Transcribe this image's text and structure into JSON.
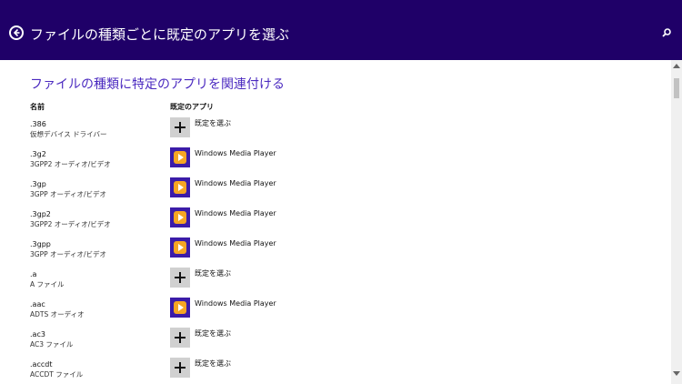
{
  "header": {
    "title": "ファイルの種類ごとに既定のアプリを選ぶ",
    "back_icon": "back-arrow-icon",
    "search_icon": "search-icon"
  },
  "section_title": "ファイルの種類に特定のアプリを関連付ける",
  "columns": {
    "name": "名前",
    "default_app": "既定のアプリ"
  },
  "rows": [
    {
      "ext": ".386",
      "desc": "仮想デバイス ドライバー",
      "app": "既定を選ぶ",
      "icon": "plus-icon"
    },
    {
      "ext": ".3g2",
      "desc": "3GPP2 オーディオ/ビデオ",
      "app": "Windows Media Player",
      "icon": "windows-media-player-icon"
    },
    {
      "ext": ".3gp",
      "desc": "3GPP オーディオ/ビデオ",
      "app": "Windows Media Player",
      "icon": "windows-media-player-icon"
    },
    {
      "ext": ".3gp2",
      "desc": "3GPP2 オーディオ/ビデオ",
      "app": "Windows Media Player",
      "icon": "windows-media-player-icon"
    },
    {
      "ext": ".3gpp",
      "desc": "3GPP オーディオ/ビデオ",
      "app": "Windows Media Player",
      "icon": "windows-media-player-icon"
    },
    {
      "ext": ".a",
      "desc": "A ファイル",
      "app": "既定を選ぶ",
      "icon": "plus-icon"
    },
    {
      "ext": ".aac",
      "desc": "ADTS オーディオ",
      "app": "Windows Media Player",
      "icon": "windows-media-player-icon"
    },
    {
      "ext": ".ac3",
      "desc": "AC3 ファイル",
      "app": "既定を選ぶ",
      "icon": "plus-icon"
    },
    {
      "ext": ".accdt",
      "desc": "ACCDT ファイル",
      "app": "既定を選ぶ",
      "icon": "plus-icon"
    }
  ],
  "colors": {
    "header_bg": "#1f0068",
    "accent": "#4b2ac0",
    "tile_plus": "#d0d0d0",
    "tile_wmp": "#3b1ca8"
  }
}
